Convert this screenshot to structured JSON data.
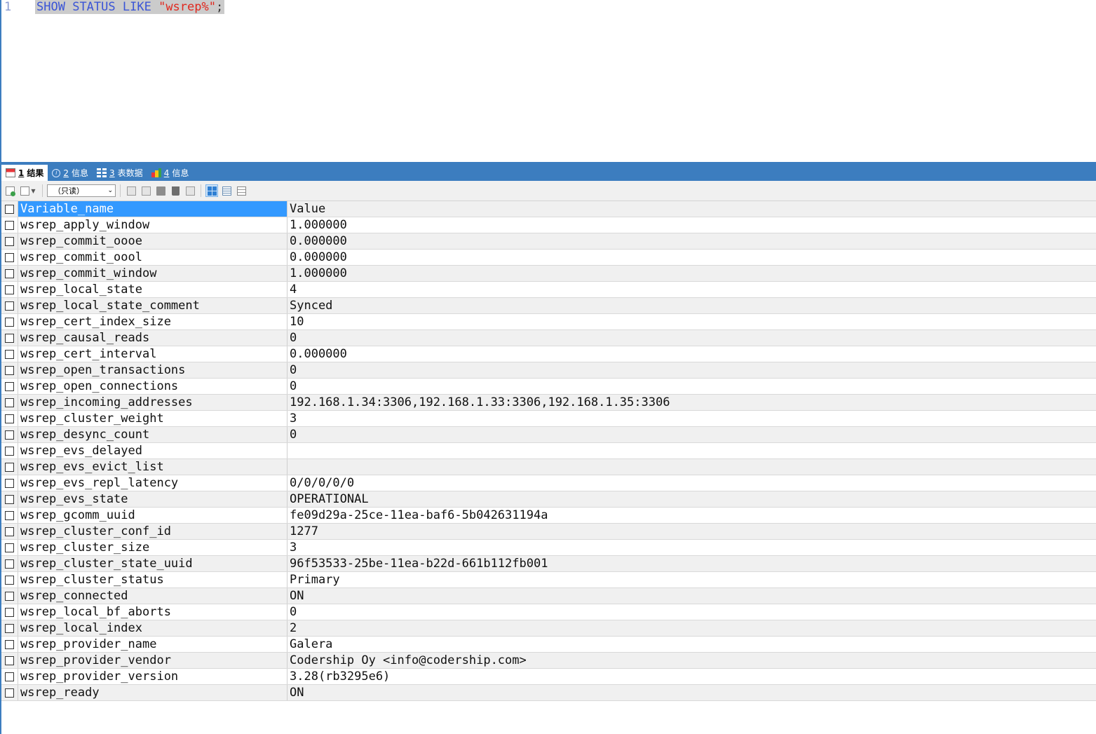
{
  "editor": {
    "line_number": "1",
    "tokens": {
      "show": "SHOW",
      "status": "STATUS",
      "like": "LIKE",
      "pattern": "\"wsrep%\"",
      "terminator": ";"
    }
  },
  "tabs": [
    {
      "num": "1",
      "label": "结果",
      "icon": "result-table-icon"
    },
    {
      "num": "2",
      "label": "信息",
      "icon": "info-icon"
    },
    {
      "num": "3",
      "label": "表数据",
      "icon": "table-data-icon"
    },
    {
      "num": "4",
      "label": "信息",
      "icon": "multi-info-icon"
    }
  ],
  "toolbar": {
    "mode_select": "（只读）"
  },
  "grid": {
    "columns": [
      "Variable_name",
      "Value"
    ],
    "rows": [
      [
        "wsrep_apply_window",
        "1.000000"
      ],
      [
        "wsrep_commit_oooe",
        "0.000000"
      ],
      [
        "wsrep_commit_oool",
        "0.000000"
      ],
      [
        "wsrep_commit_window",
        "1.000000"
      ],
      [
        "wsrep_local_state",
        "4"
      ],
      [
        "wsrep_local_state_comment",
        "Synced"
      ],
      [
        "wsrep_cert_index_size",
        "10"
      ],
      [
        "wsrep_causal_reads",
        "0"
      ],
      [
        "wsrep_cert_interval",
        "0.000000"
      ],
      [
        "wsrep_open_transactions",
        "0"
      ],
      [
        "wsrep_open_connections",
        "0"
      ],
      [
        "wsrep_incoming_addresses",
        "192.168.1.34:3306,192.168.1.33:3306,192.168.1.35:3306"
      ],
      [
        "wsrep_cluster_weight",
        "3"
      ],
      [
        "wsrep_desync_count",
        "0"
      ],
      [
        "wsrep_evs_delayed",
        ""
      ],
      [
        "wsrep_evs_evict_list",
        ""
      ],
      [
        "wsrep_evs_repl_latency",
        "0/0/0/0/0"
      ],
      [
        "wsrep_evs_state",
        "OPERATIONAL"
      ],
      [
        "wsrep_gcomm_uuid",
        "fe09d29a-25ce-11ea-baf6-5b042631194a"
      ],
      [
        "wsrep_cluster_conf_id",
        "1277"
      ],
      [
        "wsrep_cluster_size",
        "3"
      ],
      [
        "wsrep_cluster_state_uuid",
        "96f53533-25be-11ea-b22d-661b112fb001"
      ],
      [
        "wsrep_cluster_status",
        "Primary"
      ],
      [
        "wsrep_connected",
        "ON"
      ],
      [
        "wsrep_local_bf_aborts",
        "0"
      ],
      [
        "wsrep_local_index",
        "2"
      ],
      [
        "wsrep_provider_name",
        "Galera"
      ],
      [
        "wsrep_provider_vendor",
        "Codership Oy <info@codership.com>"
      ],
      [
        "wsrep_provider_version",
        "3.28(rb3295e6)"
      ],
      [
        "wsrep_ready",
        "ON"
      ]
    ]
  },
  "colors": {
    "accent": "#3c7dbf",
    "selection": "#3399ff",
    "keyword": "#3a54d6",
    "string": "#e0281e"
  }
}
